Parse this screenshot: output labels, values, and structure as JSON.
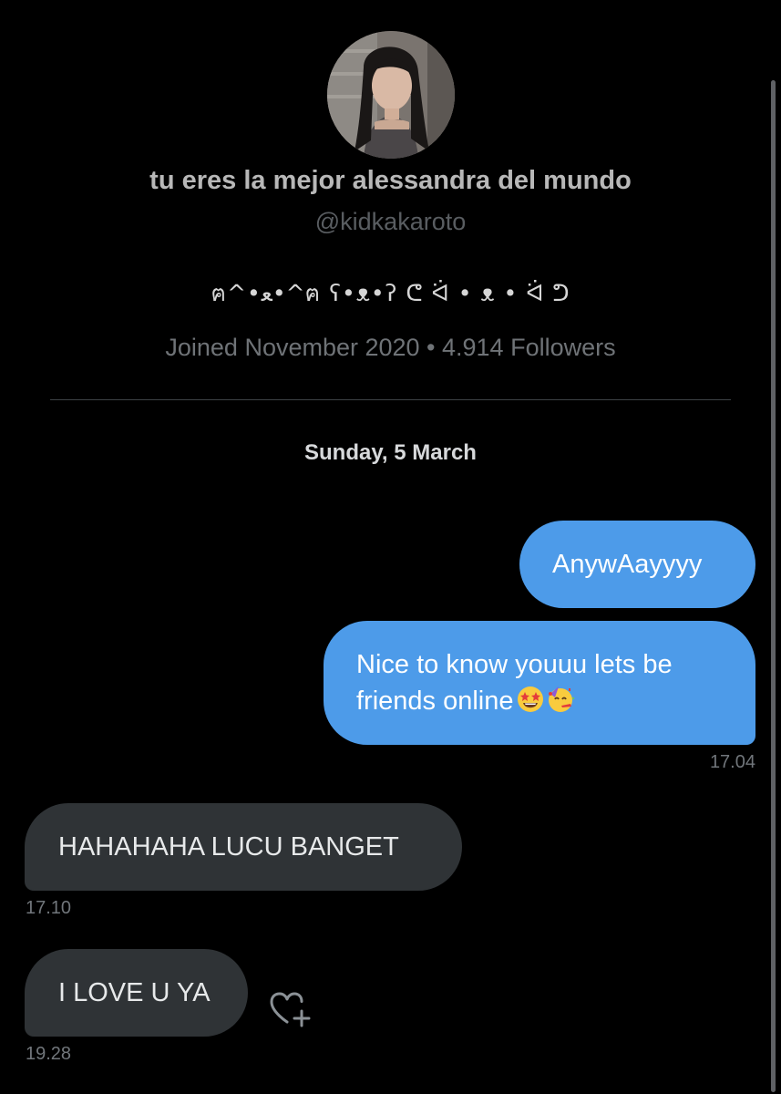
{
  "profile": {
    "display_name": "tu eres la mejor alessandra del mundo",
    "handle": "@kidkakaroto",
    "bio": "ฅ^•ﻌ•^ฅ ʕ•ᴥ•ʔ ᕦ ᐛ • ᴥ • ᐛ ᕤ",
    "meta": "Joined November 2020 • 4.914 Followers"
  },
  "conversation": {
    "date_header": "Sunday, 5 March",
    "messages": [
      {
        "direction": "outgoing",
        "text": "AnywAayyyy"
      },
      {
        "direction": "outgoing",
        "text": "Nice to know youuu lets be friends online",
        "emojis": [
          "star-struck-icon",
          "partying-face-icon"
        ],
        "time": "17.04"
      },
      {
        "direction": "incoming",
        "text": "HAHAHAHA LUCU BANGET",
        "time": "17.10"
      },
      {
        "direction": "incoming",
        "text": "I LOVE U YA",
        "time": "19.28"
      }
    ]
  },
  "icons": {
    "reaction": "heart-plus-icon"
  },
  "colors": {
    "background": "#000000",
    "outgoing_bubble": "#4d9be9",
    "incoming_bubble": "#2f3336",
    "muted_text": "#71767b"
  }
}
